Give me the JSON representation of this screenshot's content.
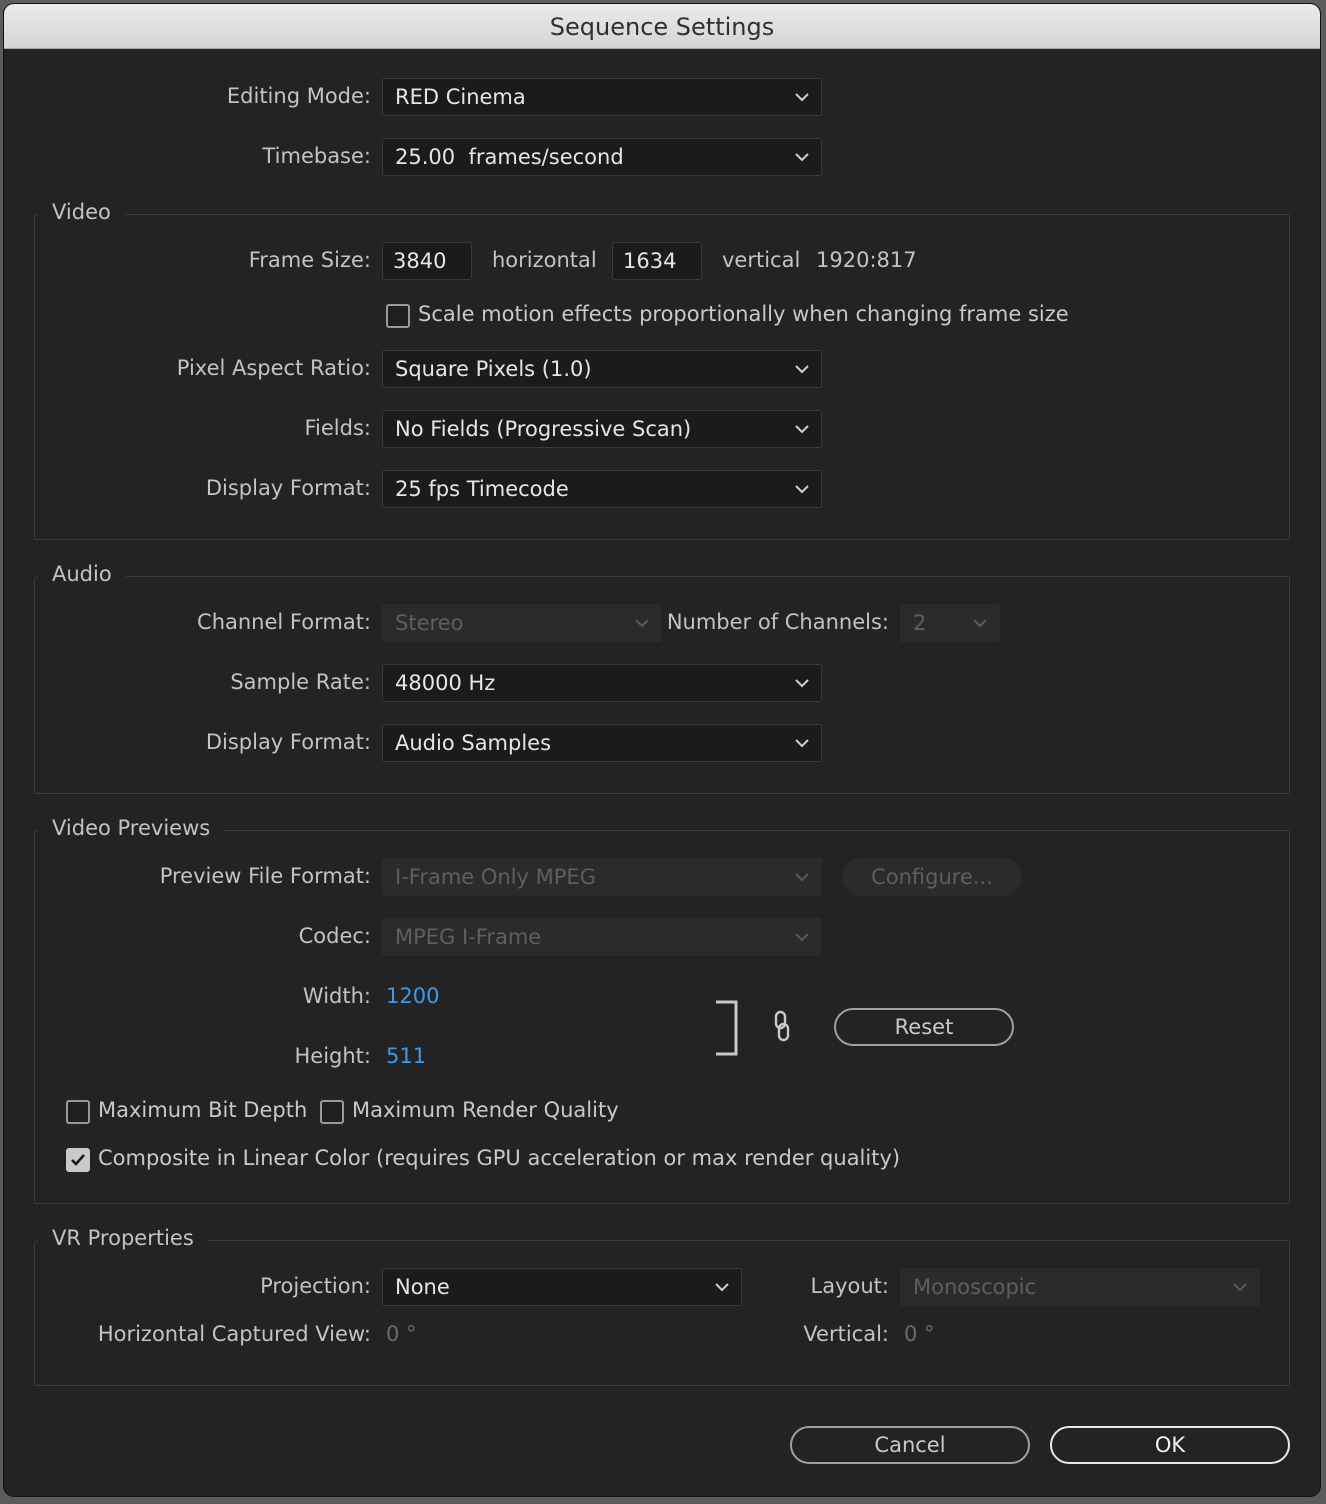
{
  "window": {
    "title": "Sequence Settings"
  },
  "general": {
    "editing_mode": {
      "label": "Editing Mode:",
      "value": "RED Cinema"
    },
    "timebase": {
      "label": "Timebase:",
      "value": "25.00  frames/second"
    }
  },
  "video": {
    "title": "Video",
    "frame_size": {
      "label": "Frame Size:",
      "horizontal": "3840",
      "horizontal_label": "horizontal",
      "vertical": "1634",
      "vertical_label": "vertical",
      "ratio": "1920:817"
    },
    "scale_motion": {
      "label": "Scale motion effects proportionally when changing frame size",
      "checked": false
    },
    "pixel_aspect": {
      "label": "Pixel Aspect Ratio:",
      "value": "Square Pixels (1.0)"
    },
    "fields": {
      "label": "Fields:",
      "value": "No Fields (Progressive Scan)"
    },
    "display_format": {
      "label": "Display Format:",
      "value": "25 fps Timecode"
    }
  },
  "audio": {
    "title": "Audio",
    "channel_format": {
      "label": "Channel Format:",
      "value": "Stereo"
    },
    "num_channels": {
      "label": "Number of Channels:",
      "value": "2"
    },
    "sample_rate": {
      "label": "Sample Rate:",
      "value": "48000 Hz"
    },
    "display_format": {
      "label": "Display Format:",
      "value": "Audio Samples"
    }
  },
  "previews": {
    "title": "Video Previews",
    "file_format": {
      "label": "Preview File Format:",
      "value": "I-Frame Only MPEG"
    },
    "configure": "Configure...",
    "codec": {
      "label": "Codec:",
      "value": "MPEG I-Frame"
    },
    "width": {
      "label": "Width:",
      "value": "1200"
    },
    "height": {
      "label": "Height:",
      "value": "511"
    },
    "reset": "Reset",
    "max_bit_depth": {
      "label": "Maximum Bit Depth",
      "checked": false
    },
    "max_render_quality": {
      "label": "Maximum Render Quality",
      "checked": false
    },
    "linear_color": {
      "label": "Composite in Linear Color (requires GPU acceleration or max render quality)",
      "checked": true
    }
  },
  "vr": {
    "title": "VR Properties",
    "projection": {
      "label": "Projection:",
      "value": "None"
    },
    "layout": {
      "label": "Layout:",
      "value": "Monoscopic"
    },
    "h_view": {
      "label": "Horizontal Captured View:",
      "value": "0 °"
    },
    "vertical": {
      "label": "Vertical:",
      "value": "0 °"
    }
  },
  "footer": {
    "cancel": "Cancel",
    "ok": "OK"
  },
  "colors": {
    "dialog_bg": "#232323",
    "accent_blue": "#3d9ae8",
    "titlebar": "#e0e0e0"
  }
}
